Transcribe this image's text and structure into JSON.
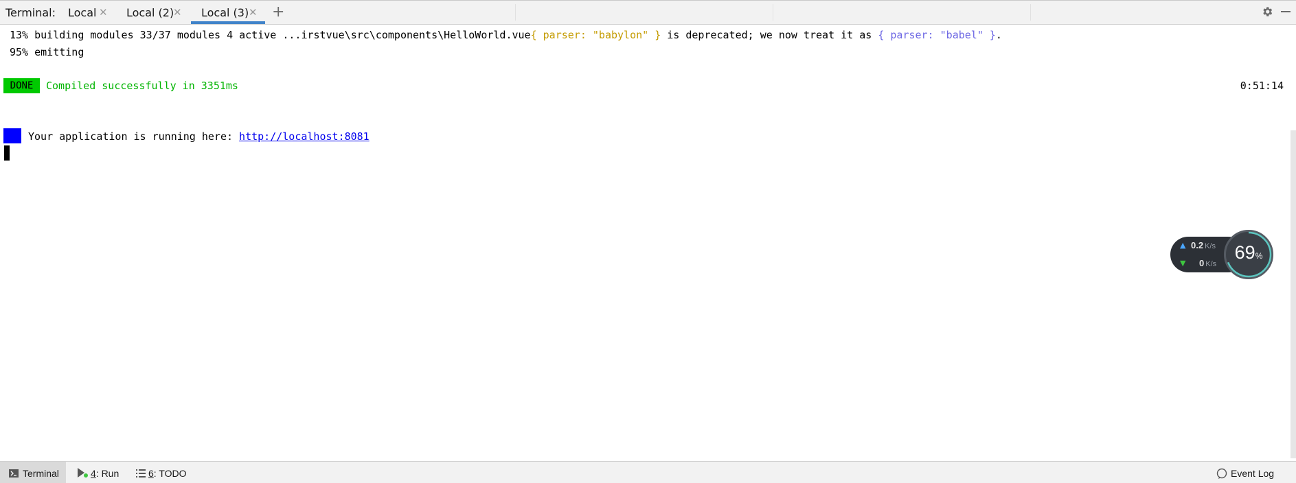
{
  "tabbar": {
    "title": "Terminal:",
    "tabs": [
      {
        "label": "Local",
        "active": false
      },
      {
        "label": "Local (2)",
        "active": false
      },
      {
        "label": "Local (3)",
        "active": true
      }
    ]
  },
  "terminal": {
    "line1_prefix": "13% building modules 33/37 modules 4 active ...irstvue\\src\\components\\HelloWorld.vue",
    "line1_yellow": "{ parser: \"babylon\" }",
    "line1_mid": " is deprecated; we now treat it as ",
    "line1_purple": "{ parser: \"babel\" }",
    "line1_end": ".",
    "line2": "95% emitting",
    "done_badge": "DONE",
    "compiled_text": "Compiled successfully in 3351ms",
    "timestamp": "0:51:14",
    "running_text": "Your application is running here: ",
    "running_url": "http://localhost:8081"
  },
  "network_widget": {
    "upload": "0.2",
    "download": "0",
    "unit": "K/s",
    "percent": "69",
    "percent_sign": "%"
  },
  "bottombar": {
    "terminal": "Terminal",
    "run_num": "4",
    "run_label": ": Run",
    "todo_num": "6",
    "todo_label": ": TODO",
    "event_log": "Event Log"
  },
  "colors": {
    "done_bg": "#00c900",
    "compiled": "#00b400",
    "info_badge": "#0000ff",
    "tab_underline": "#4083c9"
  }
}
